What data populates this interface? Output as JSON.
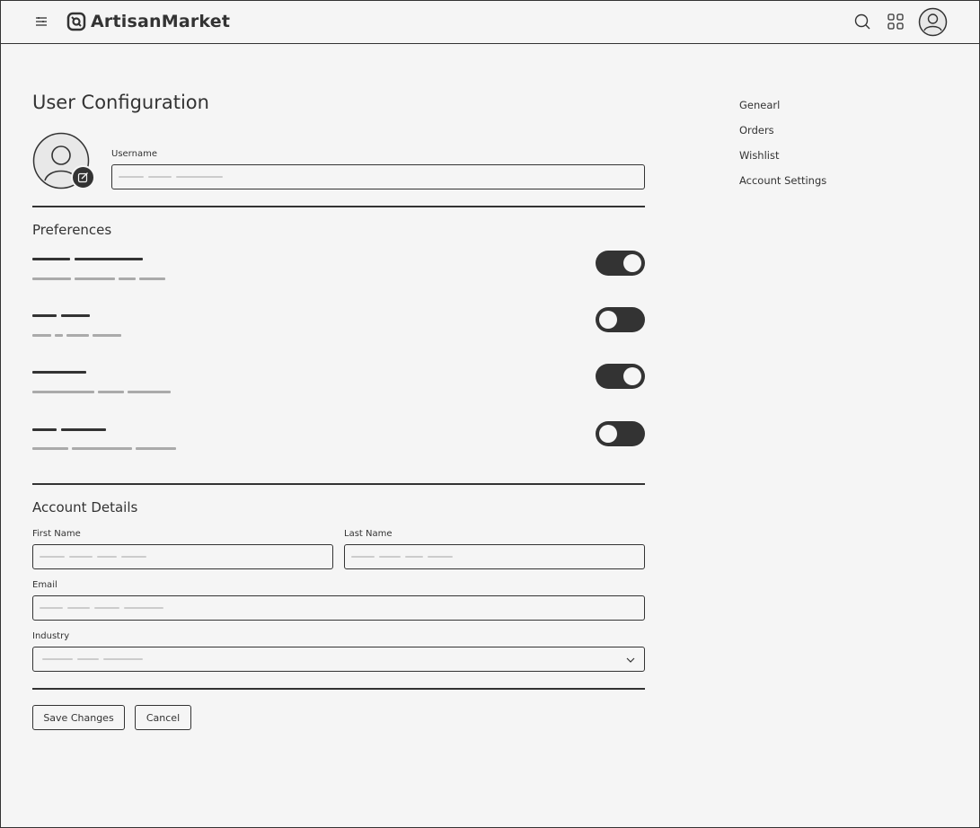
{
  "app": {
    "name": "ArtisanMarket"
  },
  "header": {
    "icons": [
      "menu-icon",
      "logo-icon",
      "search-icon",
      "apps-grid-icon",
      "user-avatar-icon"
    ]
  },
  "page": {
    "title": "User Configuration"
  },
  "profile": {
    "avatar_icon": "user-avatar-icon",
    "edit_icon": "edit-icon",
    "username_label": "Username",
    "username_value": ""
  },
  "preferences": {
    "title": "Preferences",
    "items": [
      {
        "enabled": true
      },
      {
        "enabled": false
      },
      {
        "enabled": true
      },
      {
        "enabled": false
      }
    ]
  },
  "account": {
    "title": "Account Details",
    "first_name_label": "First Name",
    "last_name_label": "Last Name",
    "email_label": "Email",
    "industry_label": "Industry"
  },
  "actions": {
    "save_label": "Save Changes",
    "cancel_label": "Cancel"
  },
  "sidebar": {
    "items": [
      {
        "label": "Genearl"
      },
      {
        "label": "Orders"
      },
      {
        "label": "Wishlist"
      },
      {
        "label": "Account Settings"
      }
    ]
  },
  "colors": {
    "background": "#f5f5f5",
    "ink": "#333333",
    "placeholder": "#cccccc",
    "muted_text_bar": "#aaaaaa"
  }
}
